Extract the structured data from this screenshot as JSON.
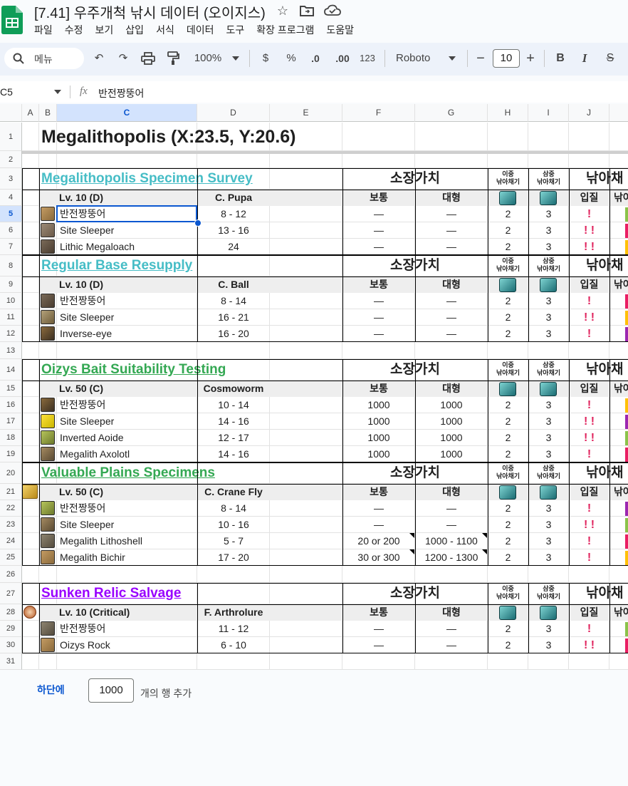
{
  "app": {
    "title": "[7.41] 우주개척 낚시 데이터 (오이지스)",
    "menus": [
      "파일",
      "수정",
      "보기",
      "삽입",
      "서식",
      "데이터",
      "도구",
      "확장 프로그램",
      "도움말"
    ]
  },
  "toolbar": {
    "search_placeholder": "메뉴",
    "zoom": "100%",
    "currency": "$",
    "percent": "%",
    "dec_decrease": ".0",
    "dec_increase": ".00",
    "number_format": "123",
    "font": "Roboto",
    "font_size": "10",
    "minus": "−",
    "plus": "+",
    "bold": "B",
    "italic": "I",
    "strike": "S"
  },
  "formula_bar": {
    "cell_ref": "C5",
    "fx": "fx",
    "value": "반전짱뚱어"
  },
  "columns": [
    "A",
    "B",
    "C",
    "D",
    "E",
    "F",
    "G",
    "H",
    "I",
    "J",
    ""
  ],
  "sheet": {
    "title": "Megalithopolis (X:23.5, Y:20.6)",
    "value_header": "소장가치",
    "double_hook": "이중\n낚아채기",
    "triple_hook": "삼중\n낚아채기",
    "catch_header": "낚아채",
    "normal": "보통",
    "large": "대형",
    "entry": "입질",
    "catch_short": "낚아",
    "dash": "—",
    "sections": [
      {
        "name": "Megalithopolis Specimen Survey",
        "color": "#46bdc6",
        "level": "Lv. 10 (D)",
        "bait": "C. Pupa",
        "fish": [
          {
            "name": "반전짱뚱어",
            "time": "8 - 12",
            "normal": "—",
            "large": "—",
            "double": "2",
            "triple": "3",
            "bites": "!"
          },
          {
            "name": "Site Sleeper",
            "time": "13 - 16",
            "normal": "—",
            "large": "—",
            "double": "2",
            "triple": "3",
            "bites": "! !"
          },
          {
            "name": "Lithic Megaloach",
            "time": "24",
            "normal": "—",
            "large": "—",
            "double": "2",
            "triple": "3",
            "bites": "! !"
          }
        ]
      },
      {
        "name": "Regular Base Resupply",
        "color": "#46bdc6",
        "level": "Lv. 10 (D)",
        "bait": "C. Ball",
        "fish": [
          {
            "name": "반전짱뚱어",
            "time": "8 - 14",
            "normal": "—",
            "large": "—",
            "double": "2",
            "triple": "3",
            "bites": "!"
          },
          {
            "name": "Site Sleeper",
            "time": "16 - 21",
            "normal": "—",
            "large": "—",
            "double": "2",
            "triple": "3",
            "bites": "! !"
          },
          {
            "name": "Inverse-eye",
            "time": "16 - 20",
            "normal": "—",
            "large": "—",
            "double": "2",
            "triple": "3",
            "bites": "!"
          }
        ]
      },
      {
        "name": "Oizys Bait Suitability Testing",
        "color": "#34a853",
        "level": "Lv. 50 (C)",
        "bait": "Cosmoworm",
        "fish": [
          {
            "name": "반전짱뚱어",
            "time": "10 - 14",
            "normal": "1000",
            "large": "1000",
            "double": "2",
            "triple": "3",
            "bites": "!"
          },
          {
            "name": "Site Sleeper",
            "time": "14 - 16",
            "normal": "1000",
            "large": "1000",
            "double": "2",
            "triple": "3",
            "bites": "! !"
          },
          {
            "name": "Inverted Aoide",
            "time": "12 - 17",
            "normal": "1000",
            "large": "1000",
            "double": "2",
            "triple": "3",
            "bites": "! !"
          },
          {
            "name": "Megalith Axolotl",
            "time": "14 - 16",
            "normal": "1000",
            "large": "1000",
            "double": "2",
            "triple": "3",
            "bites": "!"
          }
        ]
      },
      {
        "name": "Valuable Plains Specimens",
        "color": "#34a853",
        "level": "Lv. 50 (C)",
        "bait": "C. Crane Fly",
        "fish": [
          {
            "name": "반전짱뚱어",
            "time": "8 - 14",
            "normal": "—",
            "large": "—",
            "double": "2",
            "triple": "3",
            "bites": "!"
          },
          {
            "name": "Site Sleeper",
            "time": "10 - 16",
            "normal": "—",
            "large": "—",
            "double": "2",
            "triple": "3",
            "bites": "! !"
          },
          {
            "name": "Megalith Lithoshell",
            "time": "5 - 7",
            "normal": "20 or 200",
            "large": "1000 - 1100",
            "double": "2",
            "triple": "3",
            "bites": "!"
          },
          {
            "name": "Megalith Bichir",
            "time": "17 - 20",
            "normal": "30 or 300",
            "large": "1200 - 1300",
            "double": "2",
            "triple": "3",
            "bites": "!"
          }
        ]
      },
      {
        "name": "Sunken Relic Salvage",
        "color": "#9900ff",
        "level": "Lv. 10 (Critical)",
        "bait": "F. Arthrolure",
        "fish": [
          {
            "name": "반전짱뚱어",
            "time": "11 - 12",
            "normal": "—",
            "large": "—",
            "double": "2",
            "triple": "3",
            "bites": "!"
          },
          {
            "name": "Oizys Rock",
            "time": "6 - 10",
            "normal": "—",
            "large": "—",
            "double": "2",
            "triple": "3",
            "bites": "! !"
          }
        ]
      }
    ]
  },
  "footer": {
    "add_label": "하단에",
    "add_count": "1000",
    "add_suffix": "개의 행 추가"
  },
  "colors": {
    "accent": "#0b57d0",
    "toolbar_bg": "#edf2fa",
    "bite_red": "#e0245e"
  }
}
